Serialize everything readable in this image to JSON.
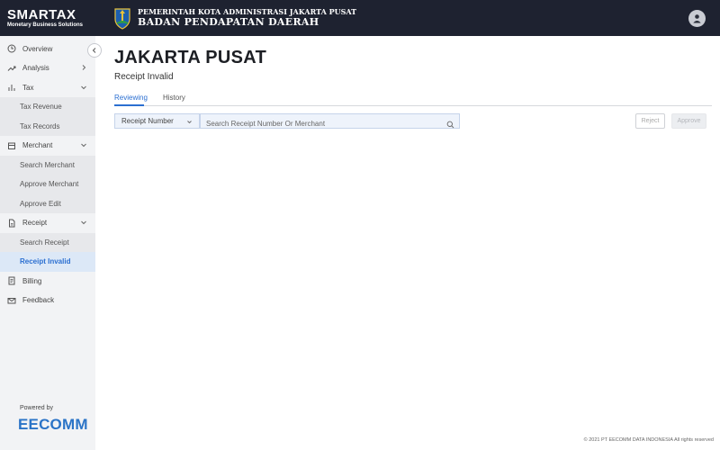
{
  "header": {
    "brand_name": "SMARTAX",
    "brand_tagline": "Monetary Business Solutions",
    "gov_line1": "PEMERINTAH KOTA ADMINISTRASI JAKARTA PUSAT",
    "gov_line2": "BADAN PENDAPATAN DAERAH"
  },
  "sidebar": {
    "items": [
      {
        "label": "Overview",
        "icon": "clock-icon"
      },
      {
        "label": "Analysis",
        "icon": "trend-icon",
        "chevron": "right"
      },
      {
        "label": "Tax",
        "icon": "bar-chart-icon",
        "chevron": "down"
      },
      {
        "label": "Tax Revenue",
        "sub": true
      },
      {
        "label": "Tax Records",
        "sub": true
      },
      {
        "label": "Merchant",
        "icon": "store-icon",
        "chevron": "down"
      },
      {
        "label": "Search Merchant",
        "sub": true
      },
      {
        "label": "Approve Merchant",
        "sub": true
      },
      {
        "label": "Approve Edit",
        "sub": true
      },
      {
        "label": "Receipt",
        "icon": "document-icon",
        "chevron": "down"
      },
      {
        "label": "Search Receipt",
        "sub": true
      },
      {
        "label": "Receipt Invalid",
        "sub": true,
        "active": true
      },
      {
        "label": "Billing",
        "icon": "billing-icon"
      },
      {
        "label": "Feedback",
        "icon": "mail-icon"
      }
    ],
    "powered_by": "Powered by",
    "powered_logo": "EECOMM"
  },
  "main": {
    "title": "JAKARTA PUSAT",
    "subtitle": "Receipt Invalid",
    "tabs": [
      {
        "label": "Reviewing",
        "active": true
      },
      {
        "label": "History",
        "active": false
      }
    ],
    "search": {
      "filter_value": "Receipt Number",
      "placeholder": "Search Receipt Number Or Merchant"
    },
    "buttons": {
      "reject": "Reject",
      "approve": "Approve"
    },
    "footer": "© 2021 PT EECOMM DATA INDONESIA All rights reserved"
  },
  "colors": {
    "header_bg": "#1e2230",
    "accent": "#2b6fd1",
    "sidebar_bg": "#f2f3f5",
    "submenu_bg": "#e7e8eb",
    "active_bg": "#dce8f7"
  }
}
